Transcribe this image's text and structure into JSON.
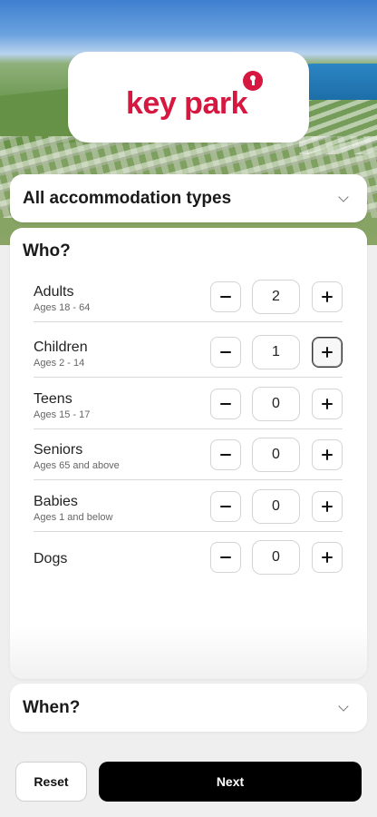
{
  "brand": {
    "logo_text": "key park",
    "brand_color": "#d6173f"
  },
  "accommodation": {
    "label": "All accommodation types",
    "icon": "chevron-down-icon"
  },
  "who": {
    "title": "Who?",
    "guests": [
      {
        "name": "Adults",
        "ages": "Ages 18 - 64",
        "count": "2"
      },
      {
        "name": "Children",
        "ages": "Ages 2 - 14",
        "count": "1"
      },
      {
        "name": "Teens",
        "ages": "Ages 15 - 17",
        "count": "0"
      },
      {
        "name": "Seniors",
        "ages": "Ages 65 and above",
        "count": "0"
      },
      {
        "name": "Babies",
        "ages": "Ages 1 and below",
        "count": "0"
      },
      {
        "name": "Dogs",
        "ages": "",
        "count": "0"
      }
    ]
  },
  "when": {
    "title": "When?",
    "icon": "chevron-down-icon"
  },
  "footer": {
    "reset_label": "Reset",
    "next_label": "Next"
  }
}
